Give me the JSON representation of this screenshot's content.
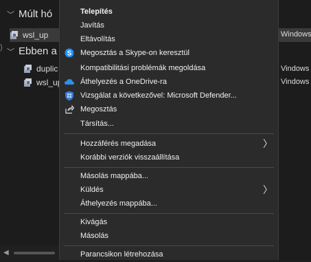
{
  "explorer": {
    "groups": [
      {
        "label": "Múlt hó"
      },
      {
        "label": "Ebben a"
      }
    ],
    "files": [
      {
        "name": "wsl_up",
        "right": "Windows"
      },
      {
        "name": "duplic",
        "right": "Vindows"
      },
      {
        "name": "wsl_up",
        "right": "Vindows"
      }
    ]
  },
  "menu": {
    "items": [
      {
        "label": "Telepítés",
        "icon": "none"
      },
      {
        "label": "Javítás",
        "icon": "none"
      },
      {
        "label": "Eltávolítás",
        "icon": "none"
      },
      {
        "label": "Megosztás a Skype-on keresztül",
        "icon": "skype-icon"
      },
      {
        "label": "Kompatibilitási problémák megoldása",
        "icon": "none"
      },
      {
        "label": "Áthelyezés a OneDrive-ra",
        "icon": "onedrive-icon"
      },
      {
        "label": "Vizsgálat a következővel: Microsoft Defender...",
        "icon": "defender-icon"
      },
      {
        "label": "Megosztás",
        "icon": "share-icon"
      },
      {
        "label": "Társítás...",
        "icon": "none"
      },
      {
        "label": "Hozzáférés megadása",
        "icon": "none"
      },
      {
        "label": "Korábbi verziók visszaállítása",
        "icon": "none"
      },
      {
        "label": "Másolás mappába...",
        "icon": "none"
      },
      {
        "label": "Küldés",
        "icon": "none"
      },
      {
        "label": "Áthelyezés mappába...",
        "icon": "none"
      },
      {
        "label": "Kivágás",
        "icon": "none"
      },
      {
        "label": "Másolás",
        "icon": "none"
      },
      {
        "label": "Parancsikon létrehozása",
        "icon": "none"
      }
    ],
    "submenu_glyph": "〉"
  },
  "colors": {
    "menu_bg": "#2b2b2b",
    "skype": "#1e90ff",
    "onedrive": "#2f8ee8",
    "defender": "#3a7bd5"
  }
}
